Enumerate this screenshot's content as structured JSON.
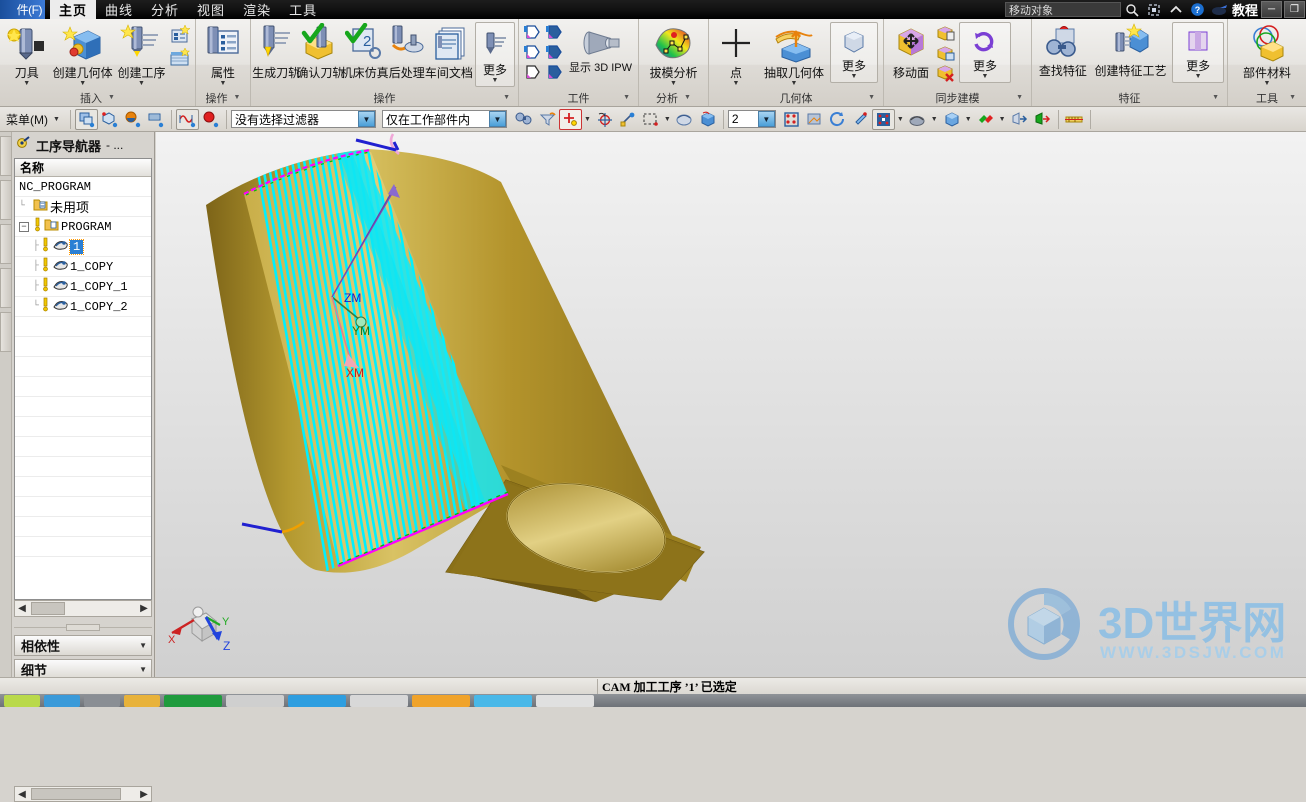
{
  "titlebar": {
    "system_menu": "件(F)",
    "tabs": [
      "主页",
      "曲线",
      "分析",
      "视图",
      "渲染",
      "工具"
    ],
    "active_tab": "主页",
    "command_box": "移动对象",
    "tutorial_label": "教程",
    "icons": [
      "search-icon",
      "fit-window-icon",
      "chevron-up-icon",
      "help-icon",
      "mouse-icon"
    ],
    "window_buttons": [
      "minimize",
      "restore",
      "close"
    ]
  },
  "ribbon": {
    "groups": [
      {
        "title": "插入",
        "buttons": [
          {
            "label": "刀具",
            "icon": "create-tool-icon",
            "dropdown": true
          },
          {
            "label": "创建几何体",
            "icon": "create-geometry-icon",
            "dropdown": true
          },
          {
            "label": "创建工序",
            "icon": "create-operation-icon",
            "dropdown": true
          }
        ],
        "small_icons": [
          "create-method-icon",
          "create-program-icon"
        ]
      },
      {
        "title": "操作",
        "buttons": [
          {
            "label": "属性",
            "icon": "properties-icon",
            "dropdown": true
          }
        ]
      },
      {
        "title": "操作",
        "buttons": [
          {
            "label": "生成刀轨",
            "icon": "generate-toolpath-icon",
            "dropdown": false
          },
          {
            "label": "确认刀轨",
            "icon": "verify-toolpath-icon",
            "dropdown": false
          },
          {
            "label": "机床仿真",
            "icon": "machine-sim-icon",
            "dropdown": false
          },
          {
            "label": "后处理",
            "icon": "post-process-icon",
            "dropdown": false
          },
          {
            "label": "车间文档",
            "icon": "shop-doc-icon",
            "dropdown": false
          },
          {
            "label": "更多",
            "icon": "more-icon",
            "dropdown": true
          }
        ]
      },
      {
        "title": "工件",
        "buttons": [
          {
            "label": "显示 3D IPW",
            "icon": "show-3d-ipw-icon",
            "dropdown": true
          }
        ],
        "small_icons": [
          "ipw-1-icon",
          "ipw-2-icon",
          "ipw-3-icon",
          "ipw-4-icon",
          "ipw-5-icon",
          "ipw-6-icon"
        ]
      },
      {
        "title": "分析",
        "buttons": [
          {
            "label": "拔模分析",
            "icon": "draft-analysis-icon",
            "dropdown": true
          }
        ]
      },
      {
        "title": "几何体",
        "buttons": [
          {
            "label": "点",
            "icon": "point-icon",
            "dropdown": true
          },
          {
            "label": "抽取几何体",
            "icon": "extract-geometry-icon",
            "dropdown": true
          },
          {
            "label": "更多",
            "icon": "more-icon",
            "dropdown": true
          }
        ]
      },
      {
        "title": "同步建模",
        "buttons": [
          {
            "label": "移动面",
            "icon": "move-face-icon",
            "dropdown": false
          },
          {
            "label": "更多",
            "icon": "more-icon",
            "dropdown": true
          }
        ],
        "small_icons": [
          "copy-face-icon",
          "resize-face-icon",
          "delete-face-icon"
        ]
      },
      {
        "title": "特征",
        "buttons": [
          {
            "label": "查找特征",
            "icon": "find-feature-icon",
            "dropdown": false
          },
          {
            "label": "创建特征工艺",
            "icon": "create-feature-process-icon",
            "dropdown": false
          },
          {
            "label": "更多",
            "icon": "more-icon",
            "dropdown": true
          }
        ]
      },
      {
        "title": "工具",
        "buttons": [
          {
            "label": "部件材料",
            "icon": "part-material-icon",
            "dropdown": true
          }
        ]
      }
    ]
  },
  "toolbar2": {
    "menu_label": "菜单(M)",
    "filter_combo": "没有选择过滤器",
    "scope_combo": "仅在工作部件内",
    "layer_combo": "2",
    "icons": [
      "select-feature-icon",
      "select-face-icon",
      "select-body-icon",
      "select-datum-icon",
      "select-curve-icon",
      "select-point-icon",
      "find-icon",
      "filter-icon",
      "snap-point-icon",
      "wcs-origin-icon",
      "select-chain-icon",
      "rect-select-icon",
      "shade-icon",
      "solid-icon",
      "layer-settings-icon",
      "layer-visible-icon",
      "orient-view-icon",
      "refresh-icon",
      "zoom-icon",
      "render-style-icon",
      "section-icon",
      "shaded-body-icon",
      "view-face-icon",
      "show-hide-icon",
      "show-hide-2-icon",
      "measure-icon"
    ]
  },
  "sidebar": {
    "navigator_title": "工序导航器",
    "navigator_title_suffix": "- ...",
    "navigator_icon": "operation-navigator-icon",
    "column_header": "名称",
    "tree": [
      {
        "label": "NC_PROGRAM",
        "indent": 0,
        "icon": null,
        "warn": false,
        "expander": null,
        "selected": false,
        "mono": true
      },
      {
        "label": "未用项",
        "indent": 1,
        "icon": "folder-icon",
        "warn": false,
        "expander": null,
        "selected": false,
        "mono": false
      },
      {
        "label": "PROGRAM",
        "indent": 1,
        "icon": "folder-icon",
        "warn": true,
        "expander": "minus",
        "selected": false,
        "mono": true
      },
      {
        "label": "1",
        "indent": 2,
        "icon": "operation-icon",
        "warn": true,
        "expander": null,
        "selected": true,
        "mono": true
      },
      {
        "label": "1_COPY",
        "indent": 2,
        "icon": "operation-icon",
        "warn": true,
        "expander": null,
        "selected": false,
        "mono": true
      },
      {
        "label": "1_COPY_1",
        "indent": 2,
        "icon": "operation-icon",
        "warn": true,
        "expander": null,
        "selected": false,
        "mono": true
      },
      {
        "label": "1_COPY_2",
        "indent": 2,
        "icon": "operation-icon",
        "warn": true,
        "expander": null,
        "selected": false,
        "mono": true
      }
    ],
    "panels": [
      {
        "label": "相依性"
      },
      {
        "label": "细节"
      }
    ]
  },
  "graphics": {
    "wcs_labels": {
      "x": "XM",
      "y": "YM",
      "z": "ZM"
    },
    "triad_labels": {
      "x": "X",
      "y": "Y",
      "z": "Z"
    },
    "colors": {
      "part_gold": "#b5942f",
      "part_gold_light": "#d8c163",
      "toolpath_cyan": "#00ffff",
      "boundary_magenta": "#ff00ff",
      "background_top": "#f2f2f2",
      "background_bottom": "#d0d0d0"
    },
    "watermark": {
      "text_cn": "3D世界网",
      "text_url": "WWW.3DSJW.COM"
    }
  },
  "statusbar": {
    "message": "CAM 加工工序 ’1’ 已选定"
  }
}
